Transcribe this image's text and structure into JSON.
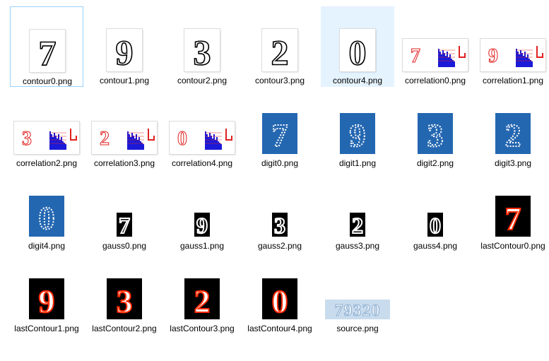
{
  "files": [
    {
      "name": "contour0.png",
      "kind": "contour",
      "digit": "7",
      "state": "selected"
    },
    {
      "name": "contour1.png",
      "kind": "contour",
      "digit": "9"
    },
    {
      "name": "contour2.png",
      "kind": "contour",
      "digit": "3"
    },
    {
      "name": "contour3.png",
      "kind": "contour",
      "digit": "2"
    },
    {
      "name": "contour4.png",
      "kind": "contour",
      "digit": "0",
      "state": "hover"
    },
    {
      "name": "correlation0.png",
      "kind": "correlation",
      "digit": "7"
    },
    {
      "name": "correlation1.png",
      "kind": "correlation",
      "digit": "9"
    },
    {
      "name": "correlation2.png",
      "kind": "correlation",
      "digit": "3"
    },
    {
      "name": "correlation3.png",
      "kind": "correlation",
      "digit": "2"
    },
    {
      "name": "correlation4.png",
      "kind": "correlation",
      "digit": "0"
    },
    {
      "name": "digit0.png",
      "kind": "digit",
      "digit": "7"
    },
    {
      "name": "digit1.png",
      "kind": "digit",
      "digit": "9"
    },
    {
      "name": "digit2.png",
      "kind": "digit",
      "digit": "3"
    },
    {
      "name": "digit3.png",
      "kind": "digit",
      "digit": "2"
    },
    {
      "name": "digit4.png",
      "kind": "digit",
      "digit": "0"
    },
    {
      "name": "gauss0.png",
      "kind": "gauss",
      "digit": "7"
    },
    {
      "name": "gauss1.png",
      "kind": "gauss",
      "digit": "9"
    },
    {
      "name": "gauss2.png",
      "kind": "gauss",
      "digit": "3"
    },
    {
      "name": "gauss3.png",
      "kind": "gauss",
      "digit": "2"
    },
    {
      "name": "gauss4.png",
      "kind": "gauss",
      "digit": "0"
    },
    {
      "name": "lastContour0.png",
      "kind": "lastContour",
      "digit": "7"
    },
    {
      "name": "lastContour1.png",
      "kind": "lastContour",
      "digit": "9"
    },
    {
      "name": "lastContour2.png",
      "kind": "lastContour",
      "digit": "3"
    },
    {
      "name": "lastContour3.png",
      "kind": "lastContour",
      "digit": "2"
    },
    {
      "name": "lastContour4.png",
      "kind": "lastContour",
      "digit": "0"
    },
    {
      "name": "source.png",
      "kind": "source",
      "digit": "79320"
    }
  ],
  "colors": {
    "selection_border": "#99d1ff",
    "hover_background": "#e5f3ff",
    "digit_blue": "#2467b1",
    "correlation_red": "#e02020",
    "correlation_blue": "#1a1ad8",
    "source_tint": "#c9dcee"
  }
}
